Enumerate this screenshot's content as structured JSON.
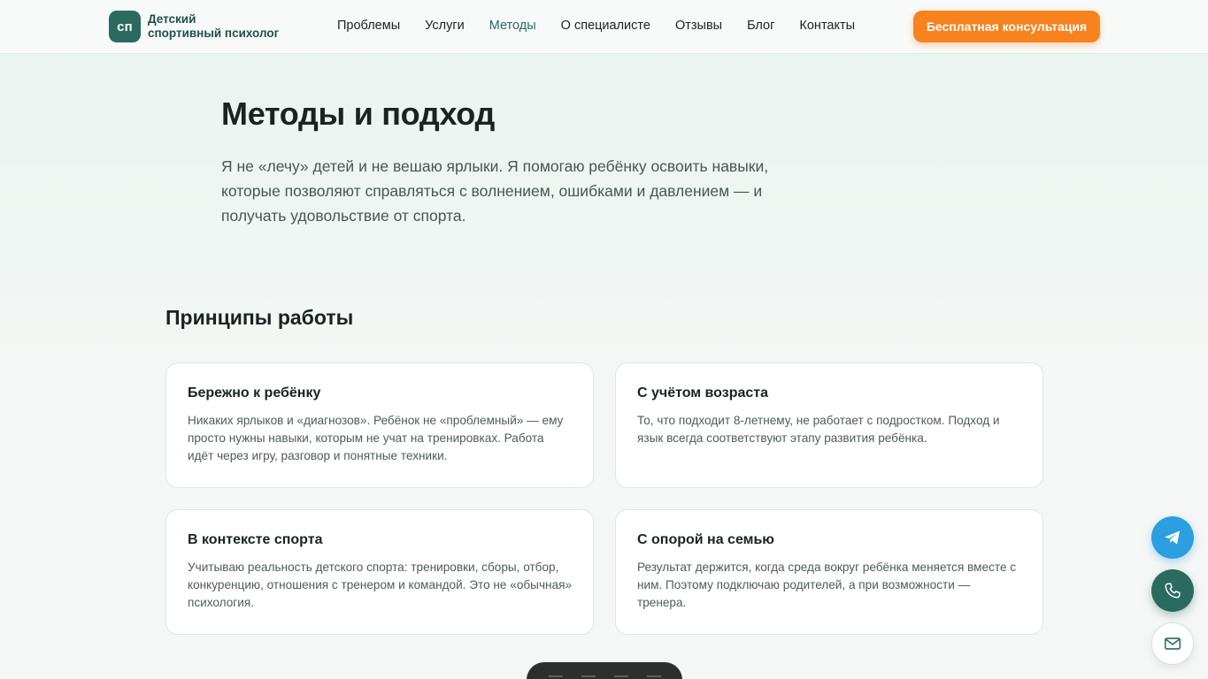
{
  "header": {
    "logo_badge": "сп",
    "logo_line1": "Детский",
    "logo_line2": "спортивный психолог",
    "nav": [
      "Проблемы",
      "Услуги",
      "Методы",
      "О специалисте",
      "Отзывы",
      "Блог",
      "Контакты"
    ],
    "active_nav": "Методы",
    "cta_label": "Бесплатная консультация"
  },
  "hero": {
    "title": "Методы и подход",
    "text": "Я не «лечу» детей и не вешаю ярлыки. Я помогаю ребёнку освоить навыки, которые позволяют справляться с волнением, ошибками и давлением — и получать удовольствие от спорта."
  },
  "principles": {
    "title": "Принципы работы",
    "cards": [
      {
        "title": "Бережно к ребёнку",
        "text": "Никаких ярлыков и «диагнозов». Ребёнок не «проблемный» — ему просто нужны навыки, которым не учат на тренировках. Работа идёт через игру, разговор и понятные техники."
      },
      {
        "title": "С учётом возраста",
        "text": "То, что подходит 8-летнему, не работает с подростком. Подход и язык всегда соответствуют этапу развития ребёнка."
      },
      {
        "title": "В контексте спорта",
        "text": "Учитываю реальность детского спорта: тренировки, сборы, отбор, конкуренцию, отношения с тренером и командой. Это не «обычная» психология."
      },
      {
        "title": "С опорой на семью",
        "text": "Результат держится, когда среда вокруг ребёнка меняется вместе с ним. Поэтому подключаю родителей, а при возможности — тренера."
      }
    ]
  },
  "floating": {
    "icons": [
      "telegram-icon",
      "phone-icon",
      "mail-icon"
    ]
  },
  "colors": {
    "brand": "#2a6a5f",
    "accent": "#f7821e",
    "telegram": "#2b9fdf"
  }
}
